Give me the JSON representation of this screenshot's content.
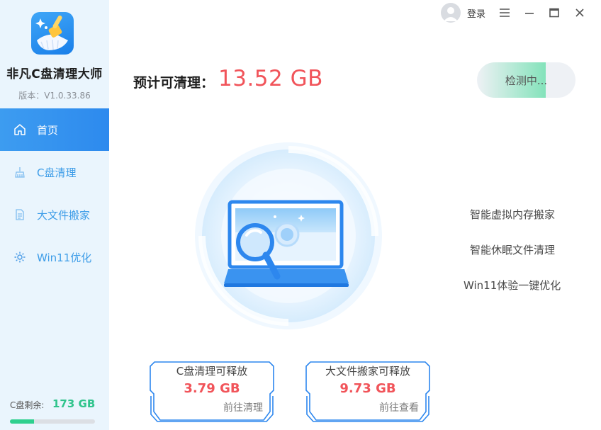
{
  "app": {
    "name": "非凡C盘清理大师",
    "version": "版本：V1.0.33.86",
    "logo_icon": "broom-icon"
  },
  "nav": {
    "items": [
      {
        "label": "首页",
        "icon": "home-icon",
        "active": true
      },
      {
        "label": "C盘清理",
        "icon": "broom-icon",
        "active": false
      },
      {
        "label": "大文件搬家",
        "icon": "file-move-icon",
        "active": false
      },
      {
        "label": "Win11优化",
        "icon": "gear-icon",
        "active": false
      }
    ]
  },
  "disk": {
    "label": "C盘剩余:",
    "value": "173 GB",
    "used_fraction": 0.28
  },
  "topbar": {
    "login": "登录",
    "avatar_icon": "user-icon",
    "menu_icon": "menu-icon",
    "minimize_icon": "minimize-icon",
    "maximize_icon": "maximize-icon",
    "close_icon": "close-icon"
  },
  "main": {
    "estimate_label": "预计可清理：",
    "estimate_value": "13.52 GB",
    "scan_button": "检测中...",
    "scan_progress": 0.7,
    "features": [
      "智能虚拟内存搬家",
      "智能休眠文件清理",
      "Win11体验一键优化"
    ],
    "cards": [
      {
        "title": "C盘清理可释放",
        "value": "3.79 GB",
        "link": "前往清理"
      },
      {
        "title": "大文件搬家可释放",
        "value": "9.73 GB",
        "link": "前往查看"
      }
    ]
  },
  "colors": {
    "accent": "#2d8aee",
    "sidebar_bg": "#eaf5fd",
    "highlight_red": "#f1545a",
    "disk_green": "#2fc48c"
  }
}
